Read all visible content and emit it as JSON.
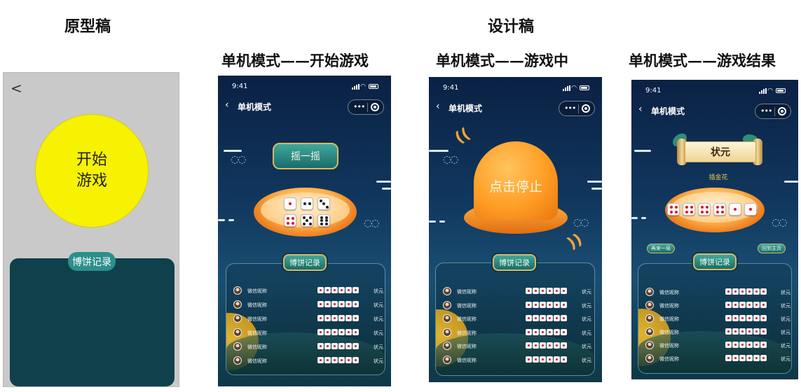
{
  "headings": {
    "prototype": "原型稿",
    "design": "设计稿",
    "screen_start": "单机模式——开始游戏",
    "screen_playing": "单机模式——游戏中",
    "screen_result": "单机模式——游戏结果"
  },
  "prototype": {
    "back": "<",
    "start_line1": "开始",
    "start_line2": "游戏",
    "record": "博饼记录",
    "colors": {
      "background": "#c9c9c9",
      "start_circle": "#f7f201",
      "panel": "#10404c",
      "record_button": "#2c8f8c"
    }
  },
  "phone": {
    "time": "9:41",
    "nav_title": "单机模式",
    "back_icon": "chevron-left-icon",
    "more_icon": "more-dots-icon",
    "close_icon": "target-circle-icon"
  },
  "start_screen": {
    "shake_button": "摇一摇"
  },
  "playing_screen": {
    "stop_button": "点击停止"
  },
  "result_screen": {
    "rank_title": "状元",
    "hand_name": "插金花",
    "again_button": "再来一局",
    "home_button": "回到主页"
  },
  "record": {
    "title": "博饼记录",
    "rows": [
      {
        "nick": "微信昵称",
        "result": "状元"
      },
      {
        "nick": "微信昵称",
        "result": "状元"
      },
      {
        "nick": "微信昵称",
        "result": "状元"
      },
      {
        "nick": "微信昵称",
        "result": "状元"
      },
      {
        "nick": "微信昵称",
        "result": "状元"
      },
      {
        "nick": "微信昵称",
        "result": "状元"
      }
    ]
  },
  "colors": {
    "bg_top": "#0a2144",
    "bg_bottom": "#0e3847",
    "bowl": "#ffb04a",
    "badge": "#2c8f8c",
    "badge_border": "#d8b76c",
    "moon": "#f4c230",
    "die_pip_red": "#d81b2a"
  }
}
